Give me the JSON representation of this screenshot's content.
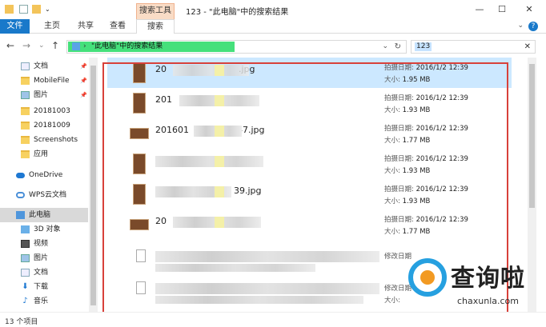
{
  "window": {
    "title": "123 - \"此电脑\"中的搜索结果",
    "contextual_tab": "搜索工具",
    "controls": [
      "—",
      "☐",
      "✕"
    ]
  },
  "ribbon": {
    "tabs": [
      "文件",
      "主页",
      "共享",
      "查看",
      "搜索"
    ],
    "help": "?"
  },
  "address": {
    "back": "←",
    "forward": "→",
    "recent": "⌄",
    "up": "↑",
    "chevron": "›",
    "path": "\"此电脑\"中的搜索结果",
    "dropdown": "⌄",
    "refresh": "↻"
  },
  "search": {
    "value": "123",
    "clear": "✕"
  },
  "nav": {
    "items": [
      {
        "label": "文档",
        "icon": "documents-icon",
        "pinned": true
      },
      {
        "label": "MobileFile",
        "icon": "folder-icon",
        "pinned": true
      },
      {
        "label": "图片",
        "icon": "pictures-icon",
        "pinned": true
      },
      {
        "label": "20181003",
        "icon": "folder-icon",
        "pinned": false
      },
      {
        "label": "20181009",
        "icon": "folder-icon",
        "pinned": false
      },
      {
        "label": "Screenshots",
        "icon": "folder-icon",
        "pinned": false
      },
      {
        "label": "应用",
        "icon": "folder-icon",
        "pinned": false
      },
      {
        "label": "OneDrive",
        "icon": "cloud-icon",
        "pinned": false
      },
      {
        "label": "WPS云文档",
        "icon": "wps-cloud-icon",
        "pinned": false
      },
      {
        "label": "此电脑",
        "icon": "this-pc-icon",
        "pinned": false
      },
      {
        "label": "3D 对象",
        "icon": "3d-objects-icon",
        "pinned": false
      },
      {
        "label": "视频",
        "icon": "videos-icon",
        "pinned": false
      },
      {
        "label": "图片",
        "icon": "pictures-icon",
        "pinned": false
      },
      {
        "label": "文档",
        "icon": "documents-icon",
        "pinned": false
      },
      {
        "label": "下载",
        "icon": "downloads-icon",
        "pinned": false
      },
      {
        "label": "音乐",
        "icon": "music-icon",
        "pinned": false
      }
    ],
    "pin_glyph": "📌"
  },
  "files": [
    {
      "name": "20",
      "ext": ".jpg",
      "meta1_label": "拍摄日期:",
      "meta1_value": "2016/1/2 12:39",
      "meta2_label": "大小:",
      "meta2_value": "1.95 MB",
      "thumb": "portrait"
    },
    {
      "name": "201",
      "ext": "",
      "meta1_label": "拍摄日期:",
      "meta1_value": "2016/1/2 12:39",
      "meta2_label": "大小:",
      "meta2_value": "1.93 MB",
      "thumb": "portrait"
    },
    {
      "name": "201601",
      "ext": "47.jpg",
      "meta1_label": "拍摄日期:",
      "meta1_value": "2016/1/2 12:39",
      "meta2_label": "大小:",
      "meta2_value": "1.77 MB",
      "thumb": "landscape"
    },
    {
      "name": "",
      "ext": "",
      "meta1_label": "拍摄日期:",
      "meta1_value": "2016/1/2 12:39",
      "meta2_label": "大小:",
      "meta2_value": "1.93 MB",
      "thumb": "portrait"
    },
    {
      "name": "",
      "ext": "39.jpg",
      "meta1_label": "拍摄日期:",
      "meta1_value": "2016/1/2 12:39",
      "meta2_label": "大小:",
      "meta2_value": "1.93 MB",
      "thumb": "portrait"
    },
    {
      "name": "20",
      "ext": "",
      "meta1_label": "拍摄日期:",
      "meta1_value": "2016/1/2 12:39",
      "meta2_label": "大小:",
      "meta2_value": "1.77 MB",
      "thumb": "landscape"
    },
    {
      "name": "",
      "ext": "",
      "meta1_label": "修改日期",
      "meta1_value": "",
      "meta2_label": "",
      "meta2_value": "",
      "thumb": "doc"
    },
    {
      "name": "",
      "ext": "",
      "meta1_label": "修改日期",
      "meta1_value": "",
      "meta2_label": "大小:",
      "meta2_value": "",
      "thumb": "doc"
    }
  ],
  "status": {
    "count": "13 个项目"
  },
  "watermark": {
    "title": "查询啦",
    "url": "chaxunla.com"
  }
}
